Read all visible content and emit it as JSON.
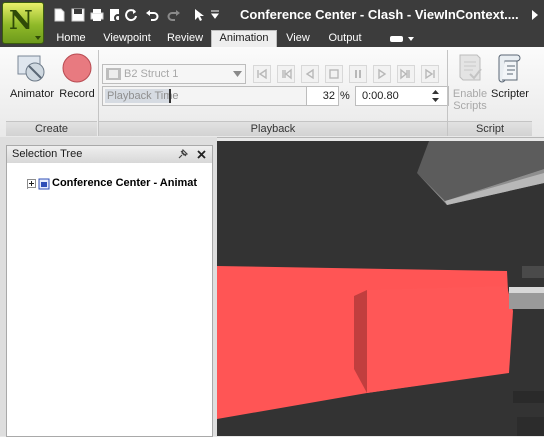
{
  "window": {
    "title": "Conference Center - Clash - ViewInContext...."
  },
  "app_logo": {
    "letter": "N"
  },
  "quick_access": [
    "new-icon",
    "save-icon",
    "print-icon",
    "refresh-icon",
    "undo-icon",
    "redo-icon",
    "select-icon",
    "dropdown-arrow-icon"
  ],
  "tabs": [
    {
      "label": "Home"
    },
    {
      "label": "Viewpoint"
    },
    {
      "label": "Review"
    },
    {
      "label": "Animation",
      "active": true
    },
    {
      "label": "View"
    },
    {
      "label": "Output"
    }
  ],
  "ribbon": {
    "create": {
      "animator_label": "Animator",
      "record_label": "Record",
      "group_label": "Create"
    },
    "playback": {
      "animation_select": "B2 Struct 1",
      "playback_time_placeholder": "Playback Time",
      "percent_value": "32",
      "percent_unit": "%",
      "time_value": "0:00.80",
      "group_label": "Playback"
    },
    "script": {
      "enable_label_1": "Enable",
      "enable_label_2": "Scripts",
      "scripter_label": "Scripter",
      "group_label": "Script"
    }
  },
  "selection_tree": {
    "title": "Selection Tree",
    "items": [
      {
        "label": "Conference Center - Animat"
      }
    ]
  },
  "colors": {
    "titlebar": "#3c3c3c",
    "model_red": "#ff5252",
    "viewport_bg": "#333333"
  }
}
